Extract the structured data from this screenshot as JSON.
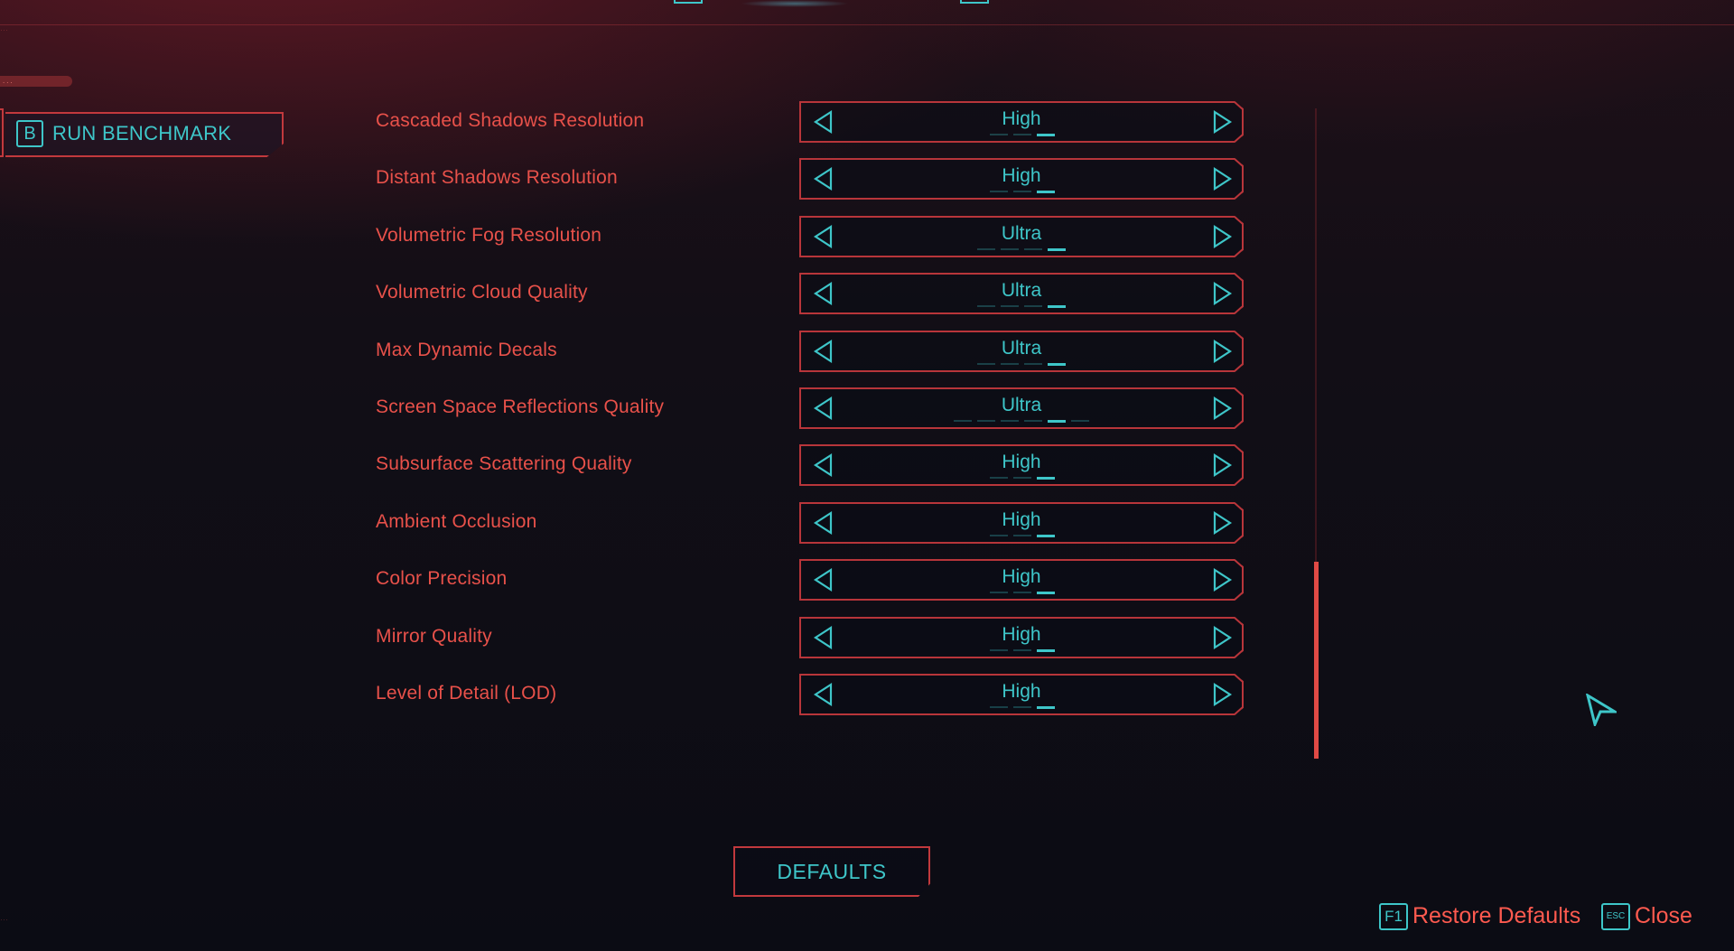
{
  "top_fine_print": "...",
  "small_tag": "...",
  "benchmark": {
    "key": "B",
    "label": "RUN BENCHMARK"
  },
  "settings": [
    {
      "label": "Cascaded Shadows Resolution",
      "value": "High"
    },
    {
      "label": "Distant Shadows Resolution",
      "value": "High"
    },
    {
      "label": "Volumetric Fog Resolution",
      "value": "Ultra"
    },
    {
      "label": "Volumetric Cloud Quality",
      "value": "Ultra"
    },
    {
      "label": "Max Dynamic Decals",
      "value": "Ultra"
    },
    {
      "label": "Screen Space Reflections Quality",
      "value": "Ultra"
    },
    {
      "label": "Subsurface Scattering Quality",
      "value": "High"
    },
    {
      "label": "Ambient Occlusion",
      "value": "High"
    },
    {
      "label": "Color Precision",
      "value": "High"
    },
    {
      "label": "Mirror Quality",
      "value": "High"
    },
    {
      "label": "Level of Detail (LOD)",
      "value": "High"
    }
  ],
  "defaults_button": "DEFAULTS",
  "hints": {
    "restore": {
      "key": "F1",
      "label": "Restore Defaults"
    },
    "close": {
      "key": "ESC",
      "label": "Close"
    }
  },
  "bottom_fine_print": "...",
  "colors": {
    "accent_red": "#e8514a",
    "accent_cyan": "#3ec6c9",
    "frame_red": "#b8353a"
  },
  "icons": {
    "left": "triangle-left-icon",
    "right": "triangle-right-icon",
    "cursor": "arrow-cursor-icon"
  }
}
